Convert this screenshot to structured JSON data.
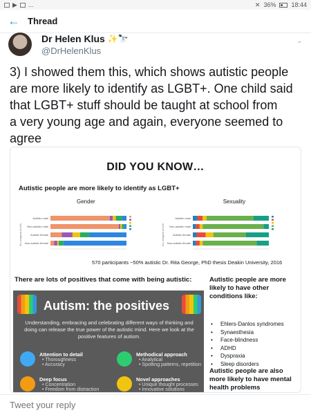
{
  "status_bar": {
    "battery": "36%",
    "time": "18:44",
    "notifications": "..."
  },
  "header": {
    "title": "Thread"
  },
  "author": {
    "name": "Dr Helen Klus",
    "handle": "@DrHelenKlus",
    "emoji": "✨🔭"
  },
  "tweet": {
    "text_lines": [
      "3) I showed them this, which shows autistic people",
      "are more likely to identify as LGBT+. One child said",
      "that LGBT+ stuff should be taught at school from",
      "a very young age and again, everyone seemed to",
      "agree"
    ]
  },
  "infographic": {
    "heading": "DID YOU KNOW…",
    "subtitle": "Autistic people are more likely to identify as LGBT+",
    "charts": {
      "gender_title": "Gender",
      "sexuality_title": "Sexuality",
      "row_labels": [
        "Autistic male",
        "Non-autistic male",
        "Autistic female",
        "Non-autistic female"
      ],
      "axis_label": "Sex assigned at birth"
    },
    "credit": "570 participants ~50% autistic Dr. Rita George, PhD thesis Deakin University, 2016",
    "positives_heading": "There are lots of positives that come with being autistic:",
    "panel": {
      "title": "Autism: the positives",
      "body": "Understanding, embracing and celebrating different ways of thinking and doing can release the true power of the autistic mind. Here we look at the positive features of autism.",
      "features": [
        {
          "title": "Attention to detail",
          "bullets": [
            "Thoroughness",
            "Accuracy"
          ]
        },
        {
          "title": "Methodical approach",
          "bullets": [
            "Analytical",
            "Spotting patterns, repetition"
          ]
        },
        {
          "title": "Deep focus",
          "bullets": [
            "Concentration",
            "Freedom from distraction"
          ]
        },
        {
          "title": "Novel approaches",
          "bullets": [
            "Unique thought processes",
            "Innovative solutions"
          ]
        }
      ]
    },
    "side": {
      "heading1": "Autistic people are more likely to have other conditions like:",
      "conditions": [
        "Ehlers-Danlos syndromes",
        "Synaesthesia",
        "Face-blindness",
        "ADHD",
        "Dyspraxia",
        "Sleep disorders"
      ],
      "heading2": "Autistic people are also more likely to have mental health problems"
    }
  },
  "composer": {
    "placeholder": "Tweet your reply"
  },
  "colors": {
    "accent": "#1da1f2",
    "panel_bg": "#5a5a5a"
  },
  "chart_data": [
    {
      "type": "bar",
      "title": "Gender",
      "categories": [
        "Autistic male",
        "Non-autistic male",
        "Autistic female",
        "Non-autistic female"
      ],
      "series": [
        {
          "values": [
            0.78,
            0.9,
            0.15,
            0.05
          ]
        },
        {
          "values": [
            0.04,
            0.02,
            0.14,
            0.04
          ]
        },
        {
          "values": [
            0.04,
            0.02,
            0.1,
            0.02
          ]
        },
        {
          "values": [
            0.08,
            0.03,
            0.12,
            0.06
          ]
        },
        {
          "values": [
            0.06,
            0.03,
            0.49,
            0.83
          ]
        }
      ],
      "colors": [
        "#f0946a",
        "#9b59b6",
        "#f1c40f",
        "#27ae60",
        "#2e86de"
      ]
    },
    {
      "type": "bar",
      "title": "Sexuality",
      "categories": [
        "Autistic male",
        "Non-autistic male",
        "Autistic female",
        "Non-autistic female"
      ],
      "series": [
        {
          "values": [
            0.06,
            0.04,
            0.05,
            0.04
          ]
        },
        {
          "values": [
            0.07,
            0.05,
            0.12,
            0.05
          ]
        },
        {
          "values": [
            0.05,
            0.04,
            0.1,
            0.04
          ]
        },
        {
          "values": [
            0.62,
            0.8,
            0.43,
            0.71
          ]
        },
        {
          "values": [
            0.2,
            0.07,
            0.3,
            0.16
          ]
        }
      ],
      "colors": [
        "#2980b9",
        "#e74c3c",
        "#f1c40f",
        "#6ab04c",
        "#16a085"
      ]
    }
  ]
}
